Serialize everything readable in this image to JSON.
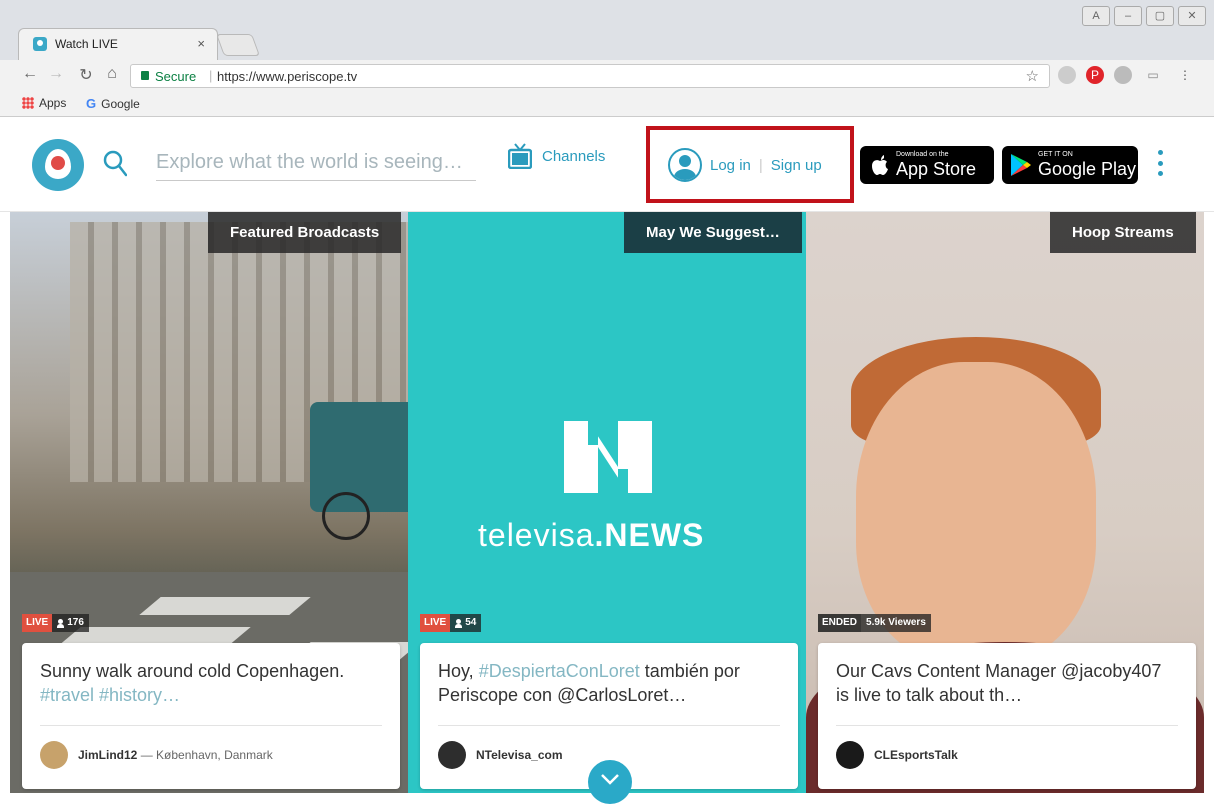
{
  "browser": {
    "tab_title": "Watch LIVE",
    "tab_close": "×",
    "secure_label": "Secure",
    "url": "https://www.periscope.tv",
    "bookmarks": [
      "Apps",
      "Google"
    ]
  },
  "header": {
    "search_placeholder": "Explore what the world is seeing…",
    "channels_label": "Channels",
    "login_label": "Log in",
    "signup_label": "Sign up",
    "separator": "|",
    "app_store_small": "Download on the",
    "app_store_big": "App Store",
    "google_play_small": "GET IT ON",
    "google_play_big": "Google Play"
  },
  "columns": [
    {
      "label": "Featured Broadcasts",
      "status": "LIVE",
      "viewers": "176",
      "caption_text": "Sunny walk around cold Copenhagen. ",
      "caption_tags": "#travel #history…",
      "author": "JimLind12",
      "location": "— København, Danmark"
    },
    {
      "label": "May We Suggest…",
      "status": "LIVE",
      "viewers": "54",
      "caption_pre": "Hoy, ",
      "caption_tag": "#DespiertaConLoret",
      "caption_post": " también por Periscope con @CarlosLoret…",
      "author": "NTelevisa_com",
      "brand_word_light": "televisa",
      "brand_word_bold": ".NEWS"
    },
    {
      "label": "Hoop Streams",
      "status": "ENDED",
      "viewers": "5.9k Viewers",
      "caption_text": "Our Cavs Content Manager @jacoby407 is live to talk about th…",
      "author": "CLEsportsTalk"
    }
  ],
  "colors": {
    "brand": "#3ba8c7",
    "live_red": "#e0503f",
    "highlight_border": "#c1121a",
    "teal_bg": "#2cc6c5"
  }
}
